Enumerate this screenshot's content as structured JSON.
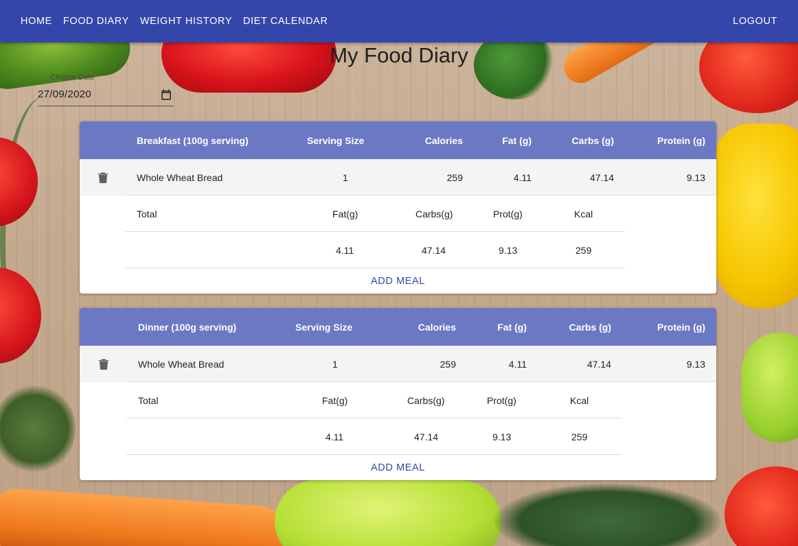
{
  "nav": {
    "home": "HOME",
    "food_diary": "FOOD DIARY",
    "weight_history": "WEIGHT HISTORY",
    "diet_calendar": "DIET CALENDAR",
    "logout": "LOGOUT"
  },
  "page_title": "My Food Diary",
  "date": {
    "label": "Choose Date",
    "value": "27/09/2020"
  },
  "colors": {
    "appbar": "#3446aa",
    "table_header": "#6b79c4",
    "action_text": "#3446aa"
  },
  "meals": [
    {
      "header": {
        "name": "Breakfast (100g serving)",
        "serving": "Serving Size",
        "calories": "Calories",
        "fat": "Fat (g)",
        "carbs": "Carbs (g)",
        "protein": "Protein (g)"
      },
      "entry": {
        "food": "Whole Wheat Bread",
        "serving": "1",
        "calories": "259",
        "fat": "4.11",
        "carbs": "47.14",
        "protein": "9.13"
      },
      "totals_labels": {
        "total": "Total",
        "fat": "Fat(g)",
        "carbs": "Carbs(g)",
        "prot": "Prot(g)",
        "kcal": "Kcal"
      },
      "totals_values": {
        "fat": "4.11",
        "carbs": "47.14",
        "prot": "9.13",
        "kcal": "259"
      },
      "add_label": "ADD MEAL"
    },
    {
      "header": {
        "name": "Dinner (100g serving)",
        "serving": "Serving Size",
        "calories": "Calories",
        "fat": "Fat (g)",
        "carbs": "Carbs (g)",
        "protein": "Protein (g)"
      },
      "entry": {
        "food": "Whole Wheat Bread",
        "serving": "1",
        "calories": "259",
        "fat": "4.11",
        "carbs": "47.14",
        "protein": "9.13"
      },
      "totals_labels": {
        "total": "Total",
        "fat": "Fat(g)",
        "carbs": "Carbs(g)",
        "prot": "Prot(g)",
        "kcal": "Kcal"
      },
      "totals_values": {
        "fat": "4.11",
        "carbs": "47.14",
        "prot": "9.13",
        "kcal": "259"
      },
      "add_label": "ADD MEAL"
    }
  ]
}
